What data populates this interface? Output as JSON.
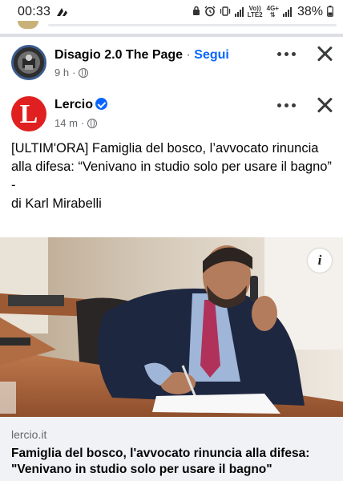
{
  "status_bar": {
    "time": "00:33",
    "network_top": "Vo))",
    "network_bottom": "LTE2",
    "network2_top": "4G+",
    "network2_bottom": "",
    "battery": "38%"
  },
  "post_prev": {
    "page_name": "Disagio 2.0 The Page",
    "separator": " · ",
    "follow_label": "Segui",
    "time": "9 h",
    "dot": "·"
  },
  "post": {
    "author": "Lercio",
    "avatar_letter": "L",
    "time": "14 m",
    "dot": "·",
    "text_lines": [
      "[ULTIM'ORA] Famiglia del bosco, l’avvocato rinuncia alla difesa: “Venivano in studio solo per usare il bagno”",
      "-",
      "di Karl Mirabelli"
    ],
    "info_label": "i"
  },
  "link_card": {
    "domain": "lercio.it",
    "title": "Famiglia del bosco, l'avvocato rinuncia alla difesa: \"Venivano in studio solo per usare il bagno\""
  },
  "colors": {
    "accent": "#0866ff",
    "lercio_red": "#e02020",
    "meta_gray": "#65676b"
  }
}
